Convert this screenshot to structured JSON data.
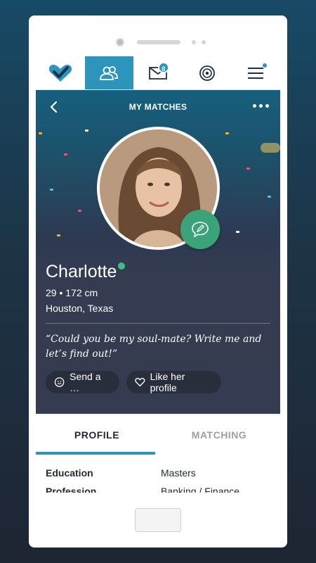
{
  "nav": {
    "messages_badge": "8"
  },
  "header": {
    "title": "MY MATCHES"
  },
  "profile": {
    "name": "Charlotte",
    "age_height": "29 • 172 cm",
    "location": "Houston, Texas",
    "quote": "“Could you be my soul-mate? Write me and let’s find out!”"
  },
  "actions": {
    "send": "Send a …",
    "like": "Like her profile"
  },
  "tabs": {
    "profile": "PROFILE",
    "matching": "MATCHING"
  },
  "details": [
    {
      "label": "Education",
      "value": "Masters"
    },
    {
      "label": "Profession",
      "value": "Banking / Finance"
    }
  ],
  "colors": {
    "accent": "#2d94bb",
    "green": "#3aa37a",
    "online": "#3fbf83"
  }
}
